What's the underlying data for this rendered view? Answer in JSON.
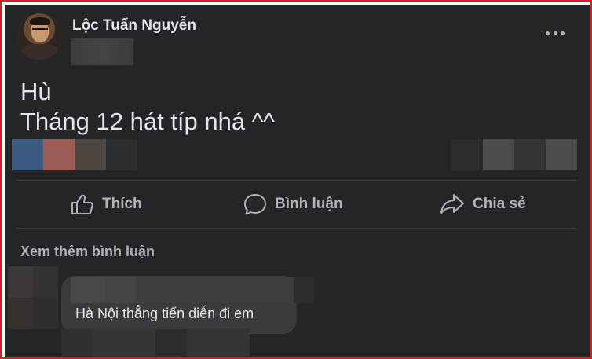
{
  "post": {
    "author": "Lộc Tuấn Nguyễn",
    "text_line1": "Hù",
    "text_line2": "Tháng 12 hát típ nhá ^^"
  },
  "actions": {
    "like": "Thích",
    "comment": "Bình luận",
    "share": "Chia sẻ"
  },
  "comments": {
    "more_label": "Xem thêm bình luận",
    "first_comment_text": "Hà Nội thẳng tiến diễn đi em"
  },
  "icons": {
    "more": "more-horizontal-icon",
    "like": "thumbs-up-icon",
    "comment": "speech-bubble-icon",
    "share": "share-arrow-icon"
  },
  "colors": {
    "background": "#242526",
    "text": "#e4e6eb",
    "secondary_text": "#b0b3b8",
    "comment_bubble": "#3a3b3c",
    "frame_border": "#d0202a"
  }
}
